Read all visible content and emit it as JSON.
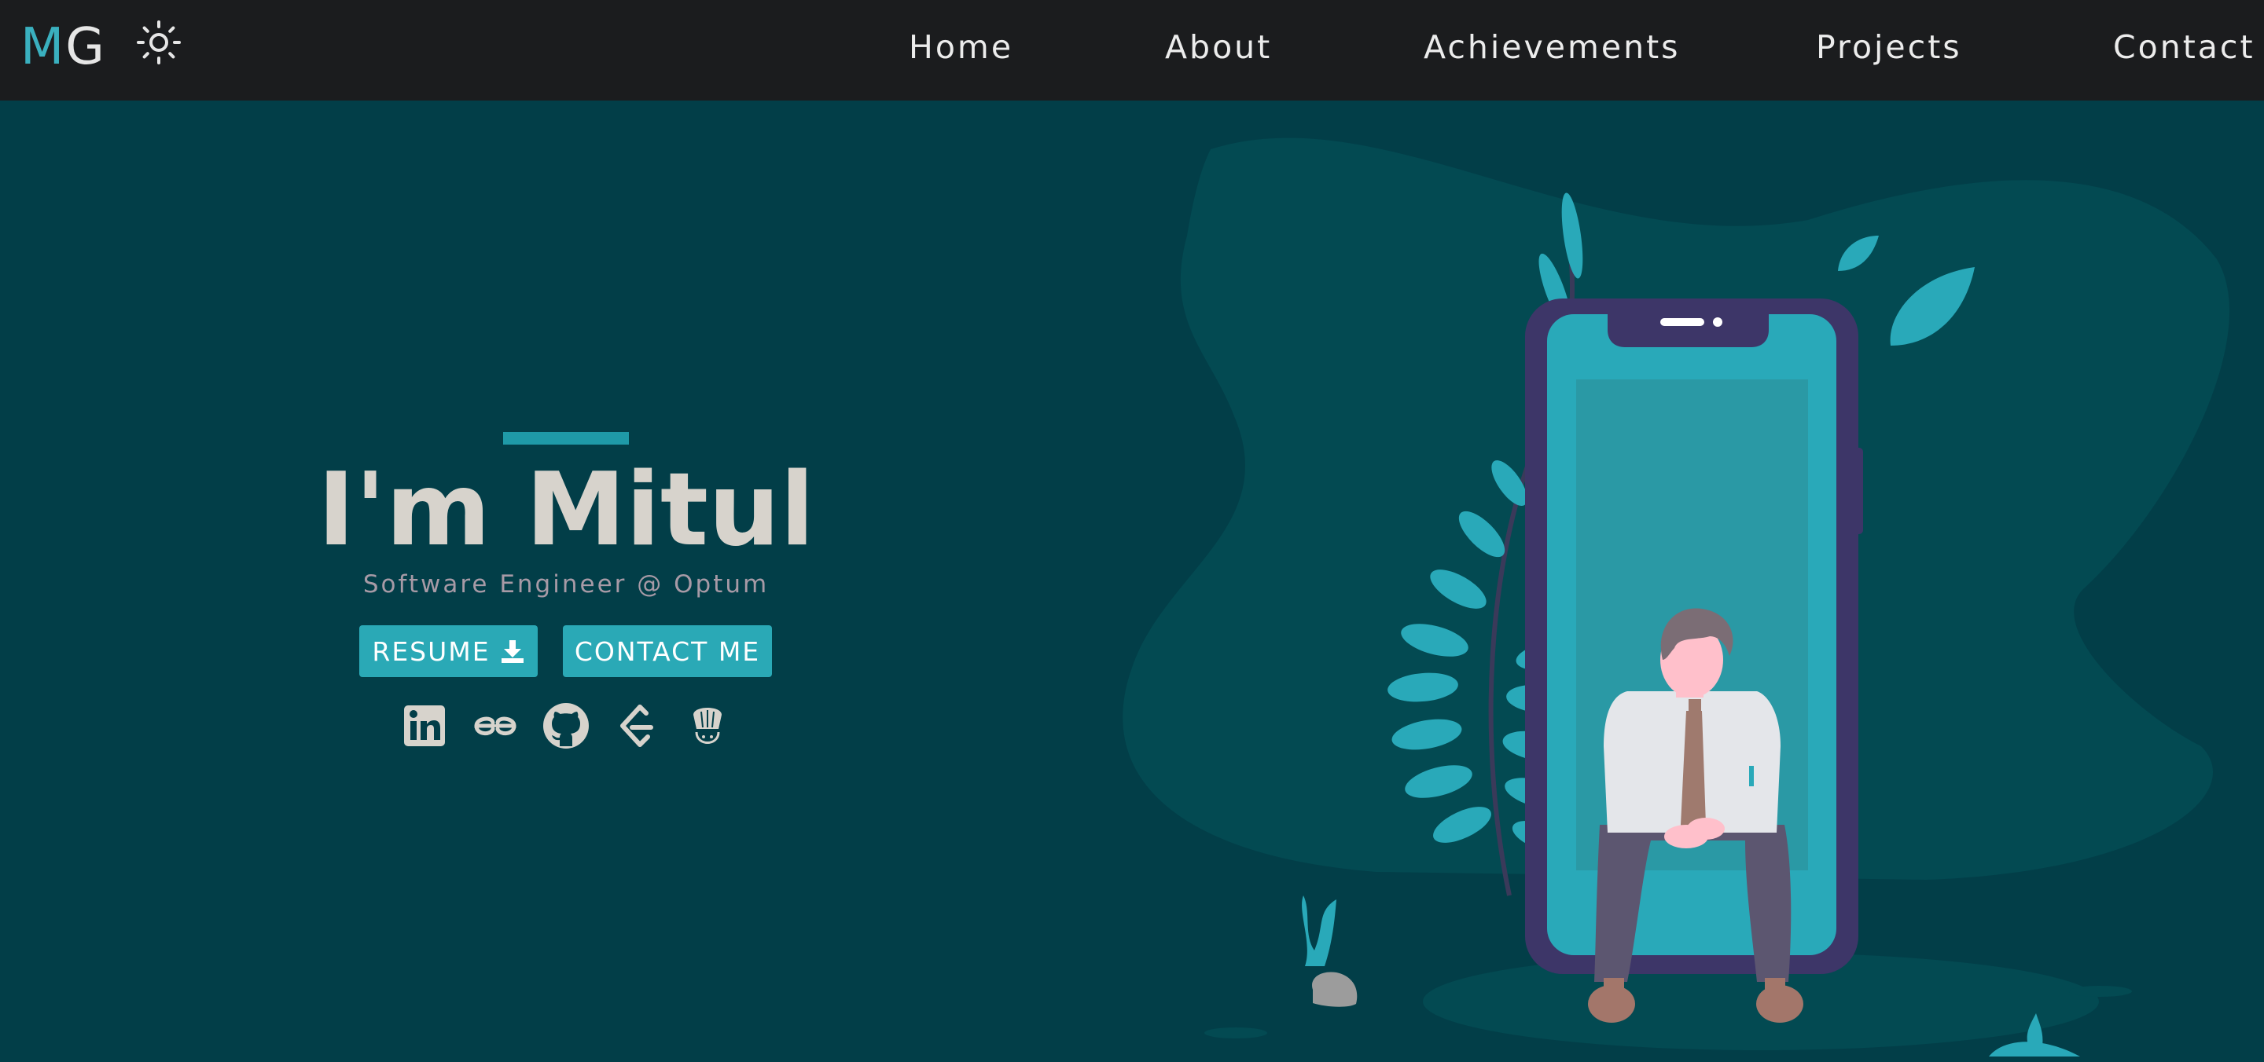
{
  "navbar": {
    "brand_first": "M",
    "brand_second": "G",
    "theme_icon": "sun-icon",
    "links": [
      "Home",
      "About",
      "Achievements",
      "Projects",
      "Contact"
    ]
  },
  "hero": {
    "title": "I'm Mitul",
    "subtitle": "Software Engineer @ Optum",
    "resume_label": "RESUME",
    "resume_icon": "download-icon",
    "contact_label": "CONTACT ME",
    "socials": [
      "linkedin-icon",
      "geeksforgeeks-icon",
      "github-icon",
      "leetcode-icon",
      "codechef-icon"
    ]
  },
  "colors": {
    "background": "#023e48",
    "navbar": "#1b1c1e",
    "accent": "#2aa9b6",
    "brand_accent": "#3ab0bf",
    "title_text": "#d7d3cc",
    "subtitle_text": "#a79aa6"
  }
}
